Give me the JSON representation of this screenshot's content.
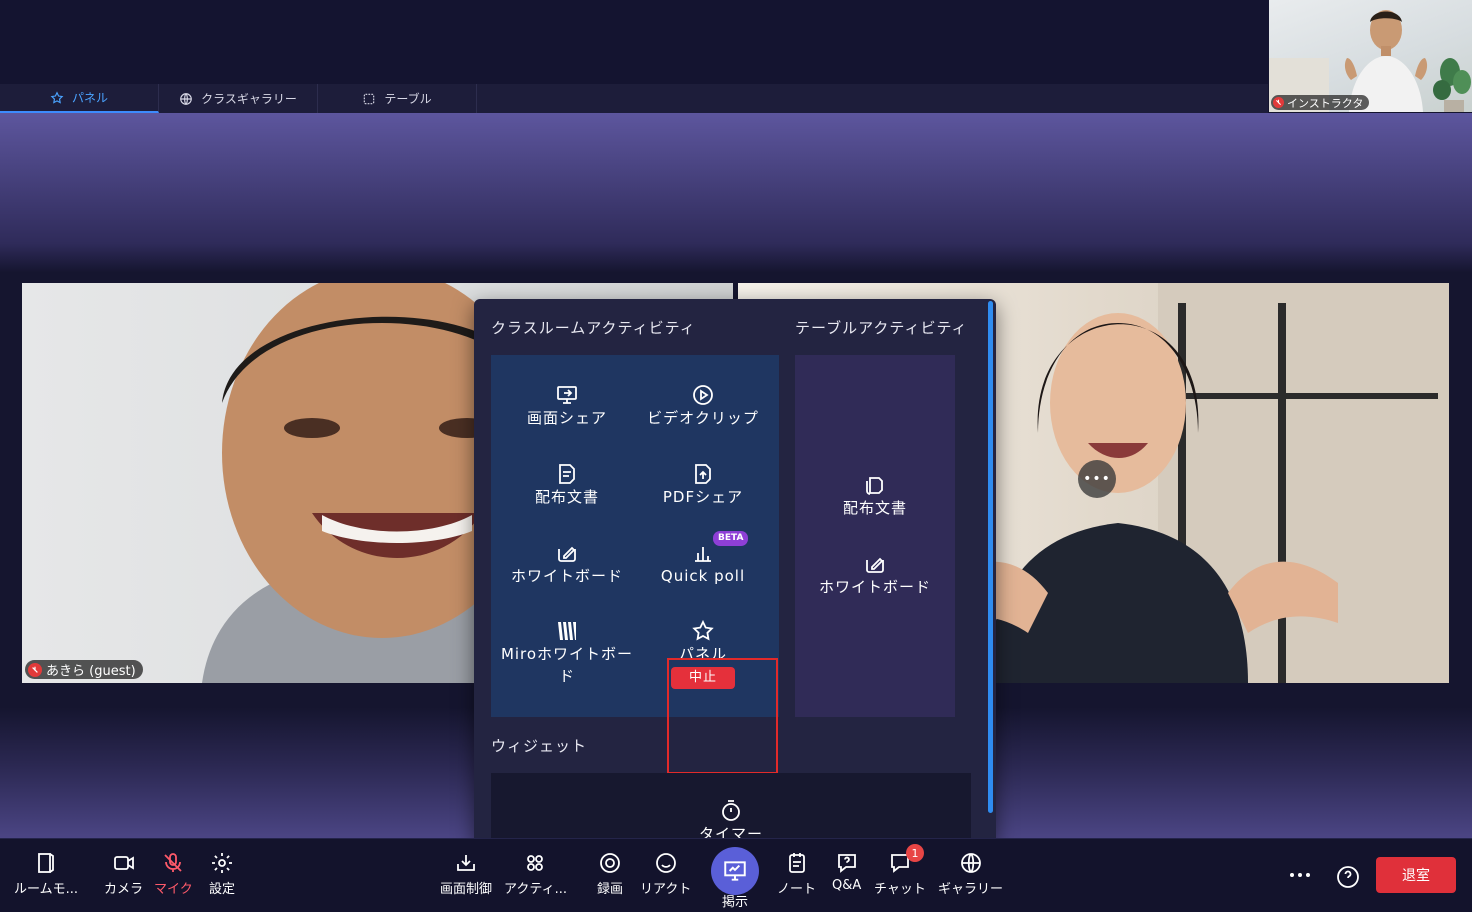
{
  "tabs": [
    {
      "label": "パネル",
      "icon": "star-icon",
      "active": true
    },
    {
      "label": "クラスギャラリー",
      "icon": "globe-grid-icon",
      "active": false
    },
    {
      "label": "テーブル",
      "icon": "table-dashed-icon",
      "active": false
    }
  ],
  "instructor": {
    "label": "インストラクタ",
    "mic": "muted"
  },
  "videos": {
    "left": {
      "label": "あきら (guest)",
      "mic": "muted"
    },
    "right": {
      "more": "•••"
    }
  },
  "panel": {
    "classroom_title": "クラスルームアクティビティ",
    "table_title": "テーブルアクティビティ",
    "widgets_title": "ウィジェット",
    "classroom_items": [
      {
        "label": "画面シェア",
        "icon": "screen-share-icon"
      },
      {
        "label": "ビデオクリップ",
        "icon": "play-circle-icon"
      },
      {
        "label": "配布文書",
        "icon": "document-icon"
      },
      {
        "label": "PDFシェア",
        "icon": "pdf-share-icon"
      },
      {
        "label": "ホワイトボード",
        "icon": "whiteboard-icon"
      },
      {
        "label": "Quick poll",
        "icon": "bar-chart-icon",
        "badge": "BETA"
      },
      {
        "label": "Miroホワイトボード",
        "icon": "miro-icon"
      },
      {
        "label": "パネル",
        "icon": "star-icon",
        "action": "中止"
      }
    ],
    "table_items": [
      {
        "label": "配布文書",
        "icon": "document-stack-icon"
      },
      {
        "label": "ホワイトボード",
        "icon": "whiteboard-icon"
      }
    ],
    "widgets": [
      {
        "label": "タイマー",
        "icon": "timer-icon"
      }
    ]
  },
  "toolbar": {
    "room_mode": "ルームモ...",
    "camera": "カメラ",
    "mic": "マイク",
    "settings": "設定",
    "screen_control": "画面制御",
    "activities": "アクティ...",
    "record": "録画",
    "react": "リアクト",
    "present": "掲示",
    "notes": "ノート",
    "qa": "Q&A",
    "chat": "チャット",
    "chat_badge": "1",
    "gallery": "ギャラリー",
    "leave": "退室"
  }
}
